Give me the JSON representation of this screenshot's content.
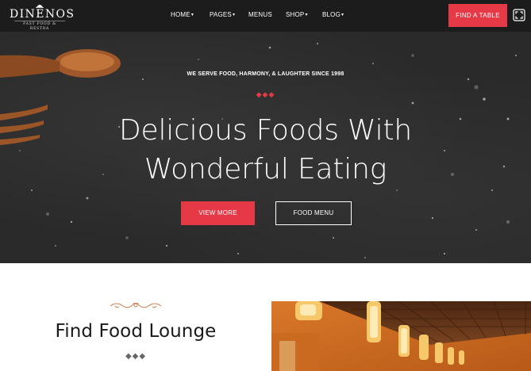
{
  "brand": {
    "name": "DINENOS",
    "tagline": "FAST FOOD & RESTRA"
  },
  "nav": {
    "items": [
      {
        "label": "HOME",
        "dropdown": true
      },
      {
        "label": "PAGES",
        "dropdown": true
      },
      {
        "label": "MENUS",
        "dropdown": false
      },
      {
        "label": "SHOP",
        "dropdown": true
      },
      {
        "label": "BLOG",
        "dropdown": true
      }
    ],
    "cta_label": "FIND A TABLE",
    "menu_icon": "expand-icon"
  },
  "hero": {
    "tagline": "WE SERVE FOOD, HARMONY, & LAUGHTER SINCE 1998",
    "divider": "◆◆◆",
    "headline_line1": "Delicious Foods With",
    "headline_line2": "Wonderful Eating",
    "primary_button": "VIEW MORE",
    "secondary_button": "FOOD MENU"
  },
  "section": {
    "title": "Find Food Lounge",
    "divider": "◆◆◆",
    "ornament_icon": "flourish-icon",
    "image": "restaurant-interior-photo"
  },
  "colors": {
    "accent": "#e63946",
    "navbar": "#1c1c1c",
    "hero_bg": "#2a2a2a",
    "ornament": "#c87a4a"
  }
}
